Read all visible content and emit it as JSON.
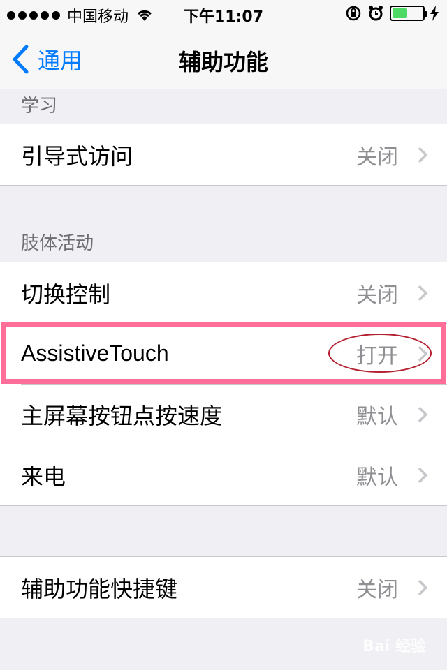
{
  "status_bar": {
    "carrier": "中国移动",
    "time": "下午11:07"
  },
  "nav": {
    "back_label": "通用",
    "title": "辅助功能"
  },
  "sections": {
    "learning_header": "学习",
    "motor_header": "肢体活动"
  },
  "rows": {
    "guided_access": {
      "label": "引导式访问",
      "value": "关闭"
    },
    "switch_control": {
      "label": "切换控制",
      "value": "关闭"
    },
    "assistive_touch": {
      "label": "AssistiveTouch",
      "value": "打开"
    },
    "home_click_speed": {
      "label": "主屏幕按钮点按速度",
      "value": "默认"
    },
    "incoming_calls": {
      "label": "来电",
      "value": "默认"
    },
    "shortcut": {
      "label": "辅助功能快捷键",
      "value": "关闭"
    }
  },
  "watermark": "Bai 经验",
  "colors": {
    "accent": "#007aff",
    "highlight": "#ff6e99",
    "annotation": "#b3202f",
    "battery": "#4cd964"
  }
}
